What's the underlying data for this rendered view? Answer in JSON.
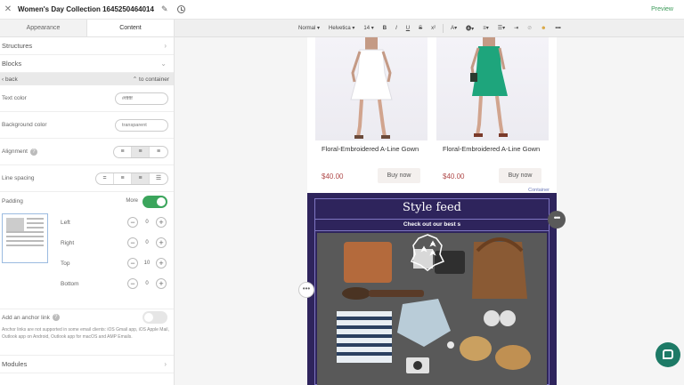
{
  "header": {
    "title": "Women's Day Collection 1645250464014",
    "preview_label": "Preview"
  },
  "sidebar": {
    "tabs": [
      {
        "label": "Appearance"
      },
      {
        "label": "Content"
      }
    ],
    "structures_label": "Structures",
    "blocks_label": "Blocks",
    "back_label": "back",
    "to_container_label": "to container",
    "text_color": {
      "label": "Text color",
      "value": "#ffffff"
    },
    "background_color": {
      "label": "Background color",
      "value": "transparent"
    },
    "alignment_label": "Alignment",
    "line_spacing_label": "Line spacing",
    "padding": {
      "label": "Padding",
      "more_label": "More",
      "enabled": true,
      "left": {
        "label": "Left",
        "value": "0"
      },
      "right": {
        "label": "Right",
        "value": "0"
      },
      "top": {
        "label": "Top",
        "value": "10"
      },
      "bottom": {
        "label": "Bottom",
        "value": "0"
      }
    },
    "anchor_link_label": "Add an anchor link",
    "anchor_note": "Anchor links are not supported in some email clients: iOS Gmail app, iOS Apple Mail, Outlook app on Android, Outlook app for macOS and AMP Emails.",
    "modules_label": "Modules"
  },
  "toolbar": {
    "format": "Normal",
    "font": "Helvetica",
    "size": "14"
  },
  "canvas": {
    "products": [
      {
        "name": "Floral-Embroidered A-Line Gown",
        "price": "$40.00",
        "button": "Buy now",
        "dress_color": "#ffffff"
      },
      {
        "name": "Floral-Embroidered A-Line Gown",
        "price": "$40.00",
        "button": "Buy now",
        "dress_color": "#1ea57c"
      }
    ],
    "style_feed": {
      "title": "Style feed",
      "subtitle": "Check out our best s",
      "container_label": "Container"
    }
  },
  "colors": {
    "accent_green": "#3ba55c",
    "style_feed_bg": "#2e245c",
    "price": "#b04a4a",
    "chat_button": "#1d7a66"
  }
}
